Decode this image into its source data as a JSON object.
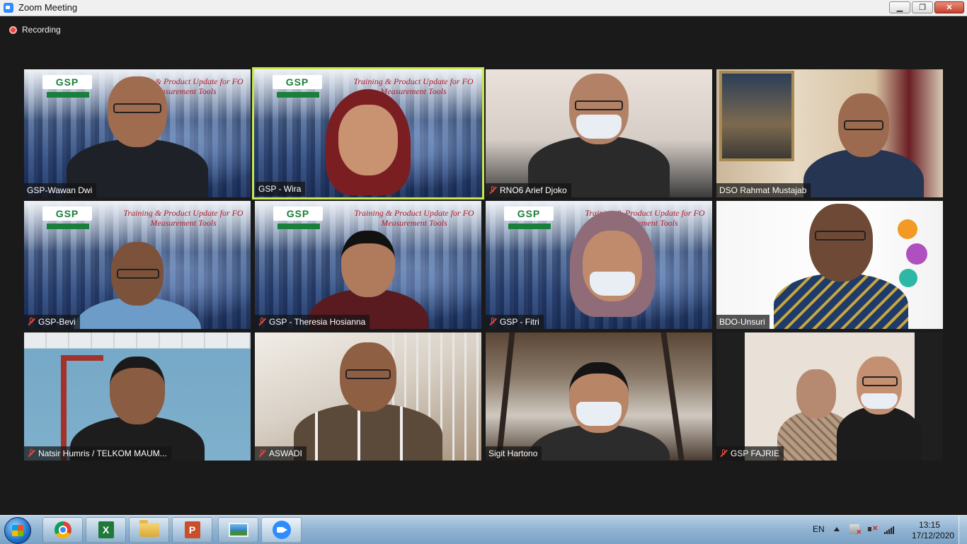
{
  "window": {
    "title": "Zoom Meeting",
    "minimize": "▁",
    "restore": "❐",
    "close": "✕"
  },
  "recording": {
    "label": "Recording"
  },
  "banner": {
    "logo": "GSP",
    "text": "Training & Product Update for FO Measurement Tools"
  },
  "participants": [
    {
      "name": "GSP-Wawan Dwi",
      "muted": false,
      "active": false
    },
    {
      "name": "GSP - Wira",
      "muted": false,
      "active": true
    },
    {
      "name": "RNO6 Arief Djoko",
      "muted": true,
      "active": false
    },
    {
      "name": "DSO Rahmat Mustajab",
      "muted": false,
      "active": false
    },
    {
      "name": "GSP-Bevi",
      "muted": true,
      "active": false
    },
    {
      "name": "GSP - Theresia Hosianna",
      "muted": true,
      "active": false
    },
    {
      "name": "GSP - Fitri",
      "muted": true,
      "active": false
    },
    {
      "name": "BDO-Unsuri",
      "muted": false,
      "active": false
    },
    {
      "name": "Natsir Humris / TELKOM MAUM...",
      "muted": true,
      "active": false
    },
    {
      "name": "ASWADI",
      "muted": true,
      "active": false
    },
    {
      "name": "Sigit Hartono",
      "muted": false,
      "active": false
    },
    {
      "name": "GSP FAJRIE",
      "muted": true,
      "active": false
    }
  ],
  "taskbar": {
    "language": "EN",
    "time": "13:15",
    "date": "17/12/2020",
    "apps": [
      "chrome-icon",
      "excel-icon",
      "file-explorer-icon",
      "powerpoint-icon",
      "photo-viewer-icon",
      "zoom-icon"
    ],
    "excel_glyph": "X",
    "ppt_glyph": "P"
  },
  "colors": {
    "active_border": "#c9e64a",
    "muted_icon": "#e0483d",
    "zoom_blue": "#2d8cff"
  }
}
